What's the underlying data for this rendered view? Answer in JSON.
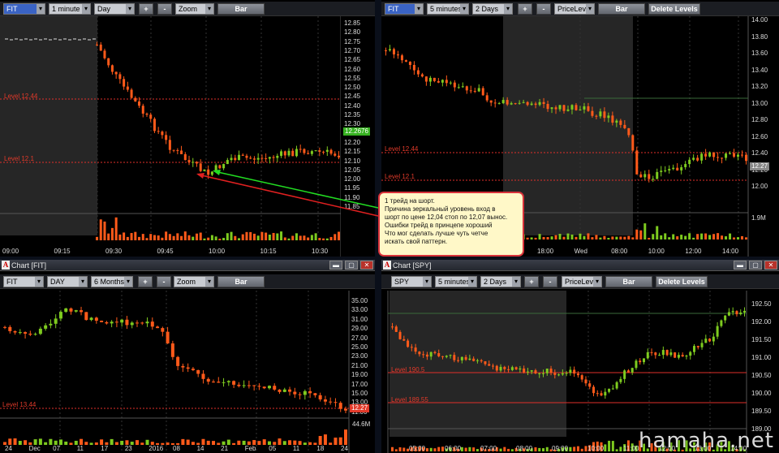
{
  "panels": {
    "top_left": {
      "toolbar": {
        "symbol": "FIT",
        "interval": "1 minute",
        "range": "Day",
        "plus": "+",
        "minus": "-",
        "zoom": "Zoom",
        "bar": "Bar"
      },
      "price_labels": [
        "12.85",
        "12.80",
        "12.75",
        "12.70",
        "12.65",
        "12.60",
        "12.55",
        "12.50",
        "12.45",
        "12.40",
        "12.35",
        "12.30",
        "12.25",
        "12.20",
        "12.15",
        "12.10",
        "12.05",
        "12.00",
        "11.95",
        "11.90",
        "11.85"
      ],
      "current_price": "12.2676",
      "levels": [
        {
          "label": "Level 12.44"
        },
        {
          "label": "Level 12.1"
        }
      ],
      "time_labels": [
        "09:00",
        "09:15",
        "09:30",
        "09:45",
        "10:00",
        "10:15",
        "10:30"
      ]
    },
    "top_right": {
      "toolbar": {
        "symbol": "FIT",
        "interval": "5 minutes",
        "range": "2 Days",
        "plus": "+",
        "minus": "-",
        "mode": "PriceLeve",
        "bar": "Bar",
        "delete": "Delete Levels"
      },
      "price_labels": [
        "14.00",
        "13.80",
        "13.60",
        "13.40",
        "13.20",
        "13.00",
        "12.80",
        "12.60",
        "12.40",
        "12.20",
        "12.00"
      ],
      "current_price": "12.27",
      "volume_label": "1.9M",
      "levels": [
        {
          "label": "Level 12.44"
        },
        {
          "label": "Level 12.1"
        }
      ],
      "time_labels": [
        "18:00",
        "Wed",
        "08:00",
        "10:00",
        "12:00",
        "14:00"
      ]
    },
    "bottom_left": {
      "title": "Chart [FIT]",
      "toolbar": {
        "symbol": "FIT",
        "interval": "DAY",
        "range": "6 Months",
        "plus": "+",
        "minus": "-",
        "zoom": "Zoom",
        "bar": "Bar"
      },
      "price_labels": [
        "35.00",
        "33.00",
        "31.00",
        "29.00",
        "27.00",
        "25.00",
        "23.00",
        "21.00",
        "19.00",
        "17.00",
        "15.00",
        "13.00",
        "11.00"
      ],
      "current_price": "12.27",
      "volume_label": "44.6M",
      "levels": [
        {
          "label": "Level 13.44"
        }
      ],
      "time_labels": [
        "24",
        "Dec",
        "07",
        "11",
        "17",
        "23",
        "2016",
        "08",
        "14",
        "21",
        "Feb",
        "05",
        "11",
        "18",
        "24"
      ]
    },
    "bottom_right": {
      "title": "Chart [SPY]",
      "toolbar": {
        "symbol": "SPY",
        "interval": "5 minutes",
        "range": "2 Days",
        "plus": "+",
        "minus": "-",
        "mode": "PriceLeve",
        "bar": "Bar",
        "delete": "Delete Levels"
      },
      "price_labels": [
        "192.50",
        "192.00",
        "191.50",
        "191.00",
        "190.50",
        "190.00",
        "189.50",
        "189.00"
      ],
      "levels": [
        {
          "label": "Level 190.5"
        },
        {
          "label": "Level 189.55"
        }
      ],
      "time_labels": [
        "05:00",
        "06:00",
        "07:00",
        "08:00",
        "09:00",
        "10:00",
        "11:00",
        "12:00",
        "13:00",
        "14:00"
      ]
    }
  },
  "callout": {
    "lines": [
      "1 трейд на шорт.",
      "Причина зеркальный уровень вход в",
      "шорт по цене 12,04 стоп по 12,07 вынос.",
      "Ошибки трейд в принцепе хороший",
      "Что мог сделать лучше чуть четче",
      "искать свой паттерн."
    ]
  },
  "window_buttons": {
    "minimize": "▬",
    "maximize": "▢",
    "close": "✕"
  },
  "watermark": "hamaha.net",
  "colors": {
    "up": "#7ecb1f",
    "down": "#ff5a1a",
    "level": "#e0302a",
    "arrow_green": "#22dd22",
    "arrow_red": "#e02020"
  }
}
